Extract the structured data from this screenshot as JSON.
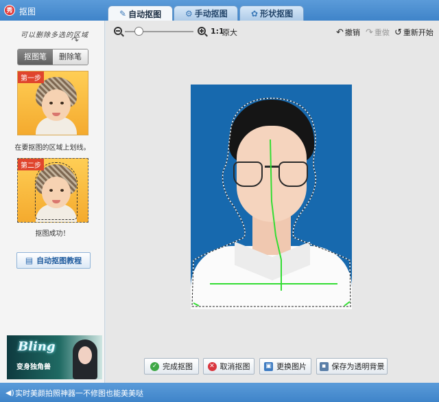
{
  "window": {
    "title": "抠图",
    "logo_text": "秀"
  },
  "tabs": [
    {
      "label": "自动抠图",
      "icon": "brush-icon",
      "active": true
    },
    {
      "label": "手动抠图",
      "icon": "gear-icon",
      "active": false
    },
    {
      "label": "形状抠图",
      "icon": "shape-icon",
      "active": false
    }
  ],
  "sidebar": {
    "hint": "可以删除多选的区域",
    "brush_mode": {
      "draw_label": "抠图笔",
      "erase_label": "删除笔",
      "selected": "抠图笔"
    },
    "step1": {
      "badge": "第一步",
      "caption": "在要抠图的区域上划线。"
    },
    "step2": {
      "badge": "第二步",
      "caption": "抠图成功！"
    },
    "tutorial_label": "自动抠图教程",
    "banner": {
      "headline": "Bling",
      "slogan": "变身独角兽"
    }
  },
  "toolbar": {
    "zoom_level": 0.2,
    "ratio_label": "1:1",
    "original_label": "原大",
    "undo_label": "撤销",
    "redo_label": "重做",
    "reset_label": "重新开始"
  },
  "actions": {
    "finish_label": "完成抠图",
    "cancel_label": "取消抠图",
    "replace_label": "更换图片",
    "save_label": "保存为透明背景"
  },
  "status": {
    "text": "实时美颜拍照神器一不修图也能美美哒"
  },
  "colors": {
    "photo_background": "#1769ae",
    "stroke": "#33dd33",
    "titlebar": "#4a90d4"
  }
}
